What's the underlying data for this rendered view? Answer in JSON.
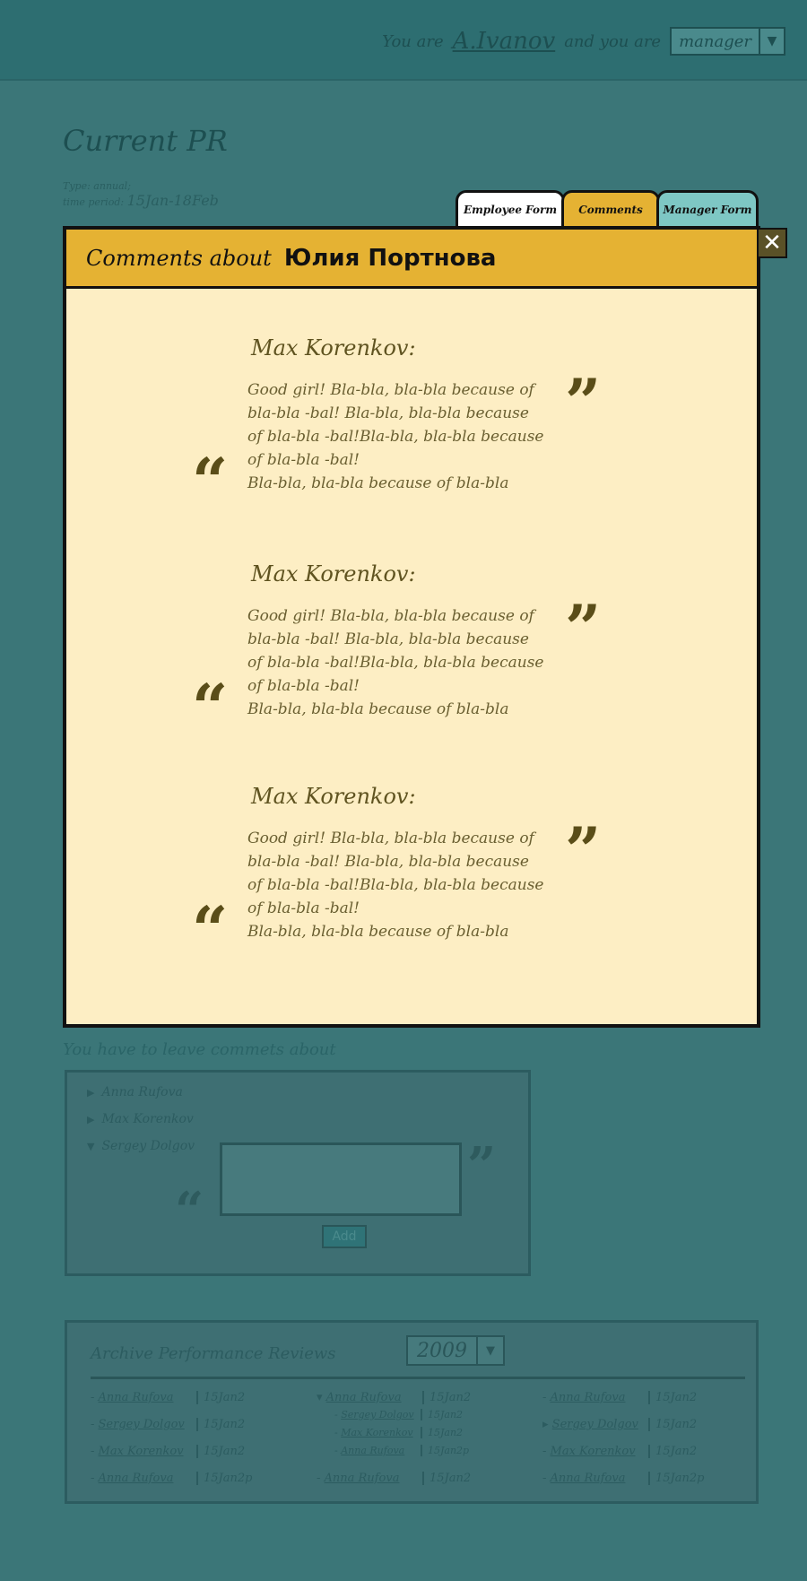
{
  "header": {
    "you_are": "You are",
    "user": "A.Ivanov",
    "and_you_are": "and you are",
    "role": "manager"
  },
  "page": {
    "title": "Current PR",
    "type_label": "Type: annual;",
    "period_label": "time period:",
    "period": "15Jan-18Feb"
  },
  "tabs": [
    {
      "label": "Employee Form"
    },
    {
      "label": "Comments"
    },
    {
      "label": "Manager Form"
    }
  ],
  "dialog": {
    "title_prefix": "Comments about",
    "employee": "Юлия Портнова",
    "comments": [
      {
        "author": "Max Korenkov:",
        "lines": [
          "Good girl! Bla-bla, bla-bla because of",
          "bla-bla -bal! Bla-bla, bla-bla because",
          "of bla-bla -bal!Bla-bla, bla-bla because",
          "of bla-bla -bal!",
          "Bla-bla, bla-bla because of bla-bla"
        ]
      },
      {
        "author": "Max Korenkov:",
        "lines": [
          "Good girl! Bla-bla, bla-bla because of",
          "bla-bla -bal! Bla-bla, bla-bla because",
          "of bla-bla -bal!Bla-bla, bla-bla because",
          "of bla-bla -bal!",
          "Bla-bla, bla-bla because of bla-bla"
        ]
      },
      {
        "author": "Max Korenkov:",
        "lines": [
          "Good girl! Bla-bla, bla-bla because of",
          "bla-bla -bal! Bla-bla, bla-bla because",
          "of bla-bla -bal!Bla-bla, bla-bla because",
          "of bla-bla -bal!",
          "Bla-bla, bla-bla because of bla-bla"
        ]
      }
    ]
  },
  "leave": {
    "title": "You have to leave commets about",
    "people": [
      "Anna Rufova",
      "Max Korenkov",
      "Sergey Dolgov"
    ],
    "add_label": "Add"
  },
  "archive": {
    "title": "Archive Performance Reviews",
    "year": "2009",
    "col1": [
      {
        "name": "Anna Rufova",
        "date": "15Jan2"
      },
      {
        "name": "Sergey Dolgov",
        "date": "15Jan2"
      },
      {
        "name": "Max Korenkov",
        "date": "15Jan2"
      },
      {
        "name": "Anna Rufova",
        "date": "15Jan2p"
      }
    ],
    "col2": [
      {
        "name": "Anna Rufova",
        "date": "15Jan2"
      },
      {
        "name": "Sergey Dolgov",
        "date": "15Jan2"
      },
      {
        "name": "Max Korenkov",
        "date": "15Jan2"
      },
      {
        "name": "Anna Rufova",
        "date": "15Jan2p"
      },
      {
        "name": "Anna Rufova",
        "date": "15Jan2"
      }
    ],
    "col3": [
      {
        "name": "Anna Rufova",
        "date": "15Jan2"
      },
      {
        "name": "Sergey Dolgov",
        "date": "15Jan2"
      },
      {
        "name": "Max Korenkov",
        "date": "15Jan2"
      },
      {
        "name": "Anna Rufova",
        "date": "15Jan2p"
      }
    ]
  }
}
